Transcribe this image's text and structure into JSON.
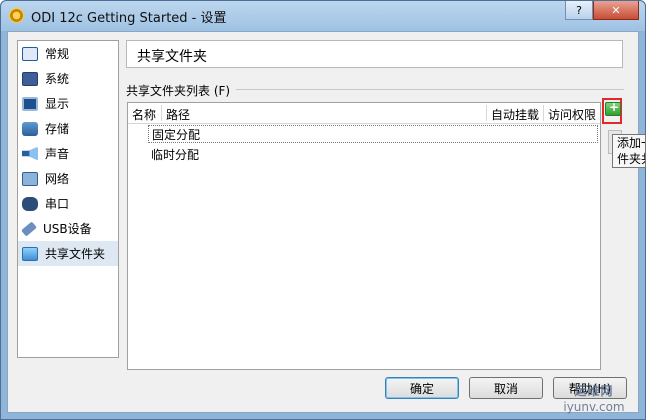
{
  "window": {
    "title": "ODI 12c Getting Started - 设置"
  },
  "window_buttons": {
    "help": "?",
    "close": "✕"
  },
  "sidebar": {
    "items": [
      {
        "label": "常规",
        "icon": "general-icon",
        "color": "#3d6fb6"
      },
      {
        "label": "系统",
        "icon": "system-icon",
        "color": "#3b5fa7"
      },
      {
        "label": "显示",
        "icon": "display-icon",
        "color": "#2f6cb7"
      },
      {
        "label": "存储",
        "icon": "storage-icon",
        "color": "#3b7bb7"
      },
      {
        "label": "声音",
        "icon": "audio-icon",
        "color": "#2e76c8"
      },
      {
        "label": "网络",
        "icon": "network-icon",
        "color": "#3f6fa8"
      },
      {
        "label": "串口",
        "icon": "serial-icon",
        "color": "#355f92"
      },
      {
        "label": "USB设备",
        "icon": "usb-icon",
        "color": "#3f6f9c"
      },
      {
        "label": "共享文件夹",
        "icon": "shared-folder-icon",
        "color": "#3a8fd6",
        "active": true
      }
    ]
  },
  "main": {
    "title": "共享文件夹",
    "section_label": "共享文件夹列表 (F)",
    "table": {
      "headers": {
        "name": "名称",
        "path": "路径",
        "auto_mount": "自动挂载",
        "access": "访问权限"
      },
      "rows": [
        {
          "label": "固定分配"
        },
        {
          "label": "临时分配"
        }
      ]
    },
    "tooltip": {
      "line1": "添加一",
      "line2": "件夹共"
    }
  },
  "buttons": {
    "ok": "确定",
    "cancel": "取消",
    "help": "帮助(H)"
  },
  "watermark": {
    "line1": "运维网",
    "line2": "iyunv.com"
  }
}
